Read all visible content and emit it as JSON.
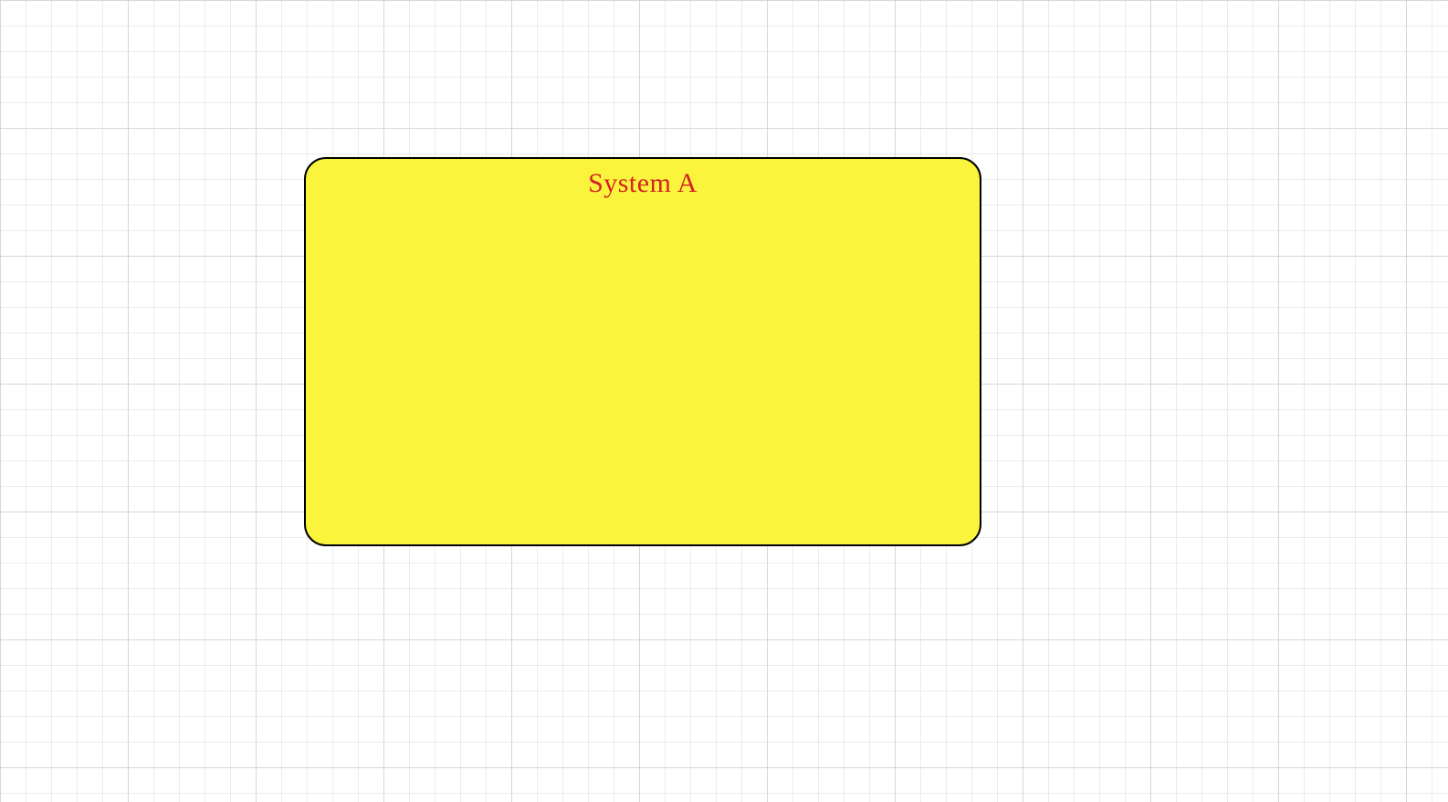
{
  "diagram": {
    "shapes": [
      {
        "id": "system-a",
        "label": "System A",
        "fill": "#faf43d",
        "stroke": "#000000",
        "text_color": "#d62222",
        "shape_type": "rounded-rectangle"
      }
    ]
  }
}
